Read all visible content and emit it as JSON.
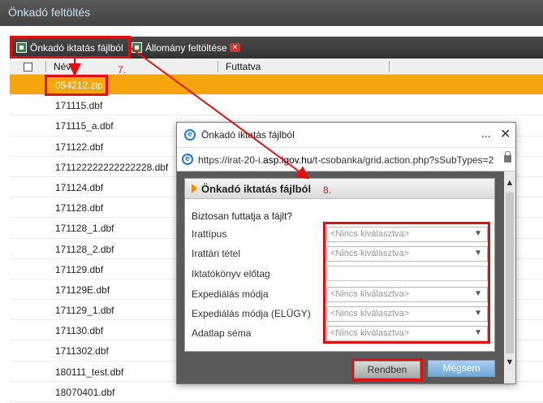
{
  "app": {
    "title": "Önkadó feltöltés"
  },
  "toolbar": {
    "import_label": "Önkadó iktatás fájlból",
    "upload_label": "Állomány feltöltése",
    "delete_icon": "delete-icon"
  },
  "grid": {
    "columns": {
      "name": "Név",
      "run": "Futtatva"
    },
    "rows": [
      "054212.zip",
      "171115.dbf",
      "171115_a.dbf",
      "171122.dbf",
      "171122222222222228.dbf",
      "171124.dbf",
      "171128.dbf",
      "171128_1.dbf",
      "171128_2.dbf",
      "171129.dbf",
      "171129E.dbf",
      "171129_1.dbf",
      "171130.dbf",
      "1711302.dbf",
      "180111_test.dbf",
      "18070401.dbf"
    ]
  },
  "annotations": {
    "step7": "7.",
    "step8": "8.",
    "color": "#e01010"
  },
  "popup": {
    "window_title": "Önkadó iktatás fájlból",
    "window_dots": "...",
    "window_close": "✕",
    "url_prefix": "https://irat-20-i.",
    "url_domain": "asp.lgov.hu",
    "url_suffix": "/t-csobanka/grid.action.php?sSubTypes=2",
    "panel_title": "Önkadó iktatás fájlból",
    "question": "Biztosan futtatja a fájlt?",
    "fields": {
      "irattipus": "Irattípus",
      "irattari": "Irattári tétel",
      "iktatokonyv": "Iktatókönyv előtag",
      "expedialas": "Expediálás módja",
      "expedialas_elugy": "Expediálás módja (ELÜGY)",
      "adatlap": "Adatlap séma"
    },
    "placeholder": "<Nincs kiválasztva>",
    "ok_label": "Rendben",
    "cancel_label": "Mégsem"
  },
  "colors": {
    "selected_row": "#f6a60c",
    "accent": "#e01010"
  }
}
